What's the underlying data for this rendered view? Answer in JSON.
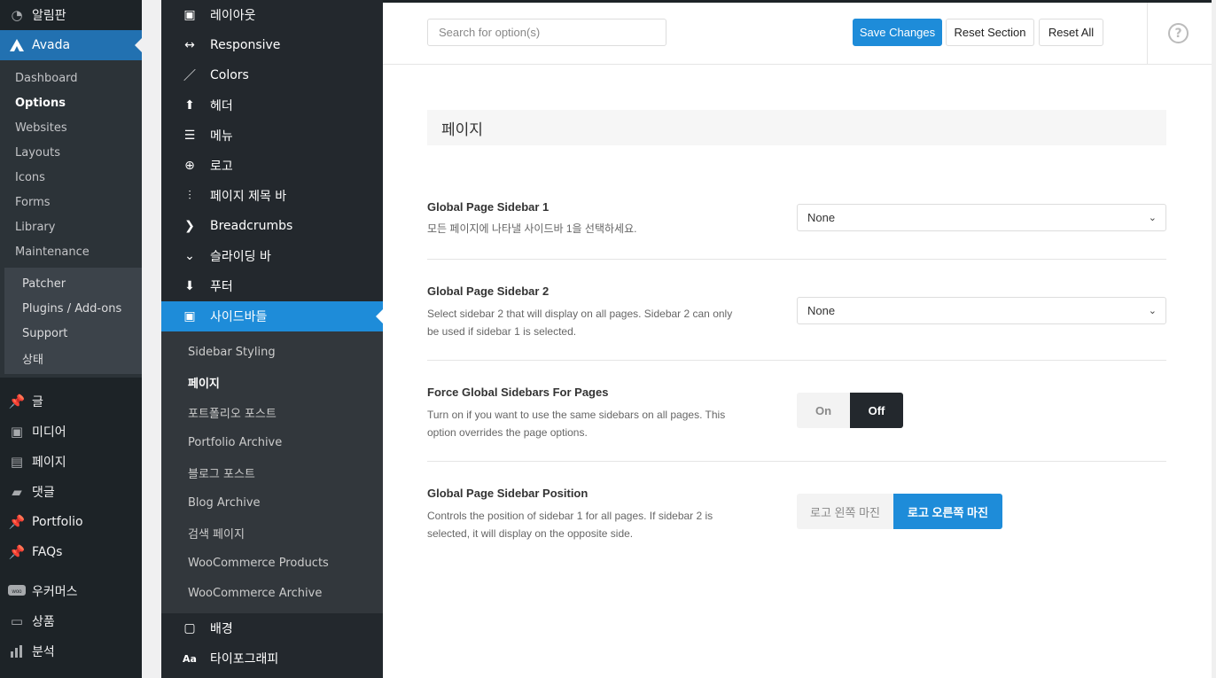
{
  "wp_menu": {
    "dashboard_label": "알림판",
    "avada_label": "Avada",
    "avada_sub": [
      "Dashboard",
      "Options",
      "Websites",
      "Layouts",
      "Icons",
      "Forms",
      "Library",
      "Maintenance"
    ],
    "maintenance_sub": [
      "Patcher",
      "Plugins / Add-ons",
      "Support",
      "상태"
    ],
    "bottom_items": [
      "글",
      "미디어",
      "페이지",
      "댓글",
      "Portfolio",
      "FAQs",
      "우커머스",
      "상품",
      "분석"
    ]
  },
  "avada_nav": {
    "items_top": [
      "레이아웃",
      "Responsive",
      "Colors",
      "헤더",
      "메뉴",
      "로고",
      "페이지 제목 바",
      "Breadcrumbs",
      "슬라이딩 바",
      "푸터"
    ],
    "active_item": "사이드바들",
    "sub_items": [
      "Sidebar Styling",
      "페이지",
      "포트폴리오 포스트",
      "Portfolio Archive",
      "블로그 포스트",
      "Blog Archive",
      "검색 페이지",
      "WooCommerce Products",
      "WooCommerce Archive"
    ],
    "items_bottom": [
      "배경",
      "타이포그래피"
    ]
  },
  "header": {
    "search_placeholder": "Search for option(s)",
    "save_label": "Save Changes",
    "reset_section_label": "Reset Section",
    "reset_all_label": "Reset All",
    "help_glyph": "?"
  },
  "section": {
    "title": "페이지"
  },
  "options": {
    "sidebar1": {
      "label": "Global Page Sidebar 1",
      "desc": "모든 페이지에 나타낼 사이드바 1을 선택하세요.",
      "value": "None"
    },
    "sidebar2": {
      "label": "Global Page Sidebar 2",
      "desc": "Select sidebar 2 that will display on all pages. Sidebar 2 can only be used if sidebar 1 is selected.",
      "value": "None"
    },
    "force": {
      "label": "Force Global Sidebars For Pages",
      "desc": "Turn on if you want to use the same sidebars on all pages. This option overrides the page options.",
      "on_label": "On",
      "off_label": "Off"
    },
    "position": {
      "label": "Global Page Sidebar Position",
      "desc": "Controls the position of sidebar 1 for all pages. If sidebar 2 is selected, it will display on the opposite side.",
      "left_label": "로고 왼쪽 마진",
      "right_label": "로고 오른쪽 마진"
    }
  },
  "colors": {
    "accent": "#1e8cd9",
    "wp_active": "#2271b1",
    "dark": "#23282d"
  }
}
